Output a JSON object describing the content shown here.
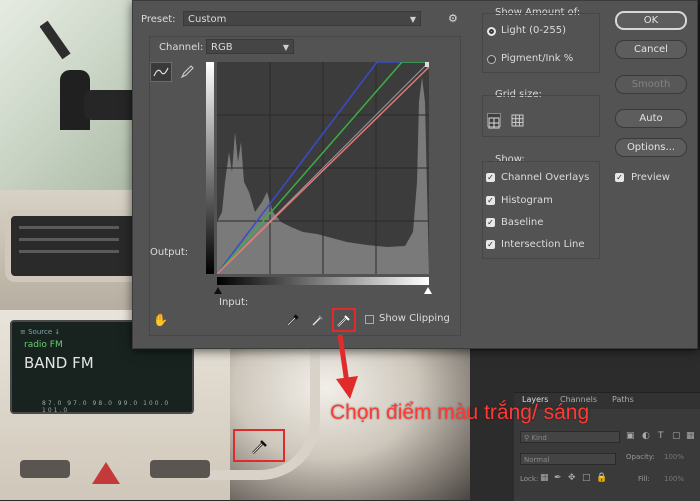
{
  "dialog": {
    "preset_label": "Preset:",
    "preset_value": "Custom",
    "channel_label": "Channel:",
    "channel_value": "RGB",
    "output_label": "Output:",
    "input_label": "Input:",
    "show_clipping_label": "Show Clipping",
    "show_amount": {
      "title": "Show Amount of:",
      "light": "Light  (0-255)",
      "pigment": "Pigment/Ink %",
      "selected": "light"
    },
    "grid_size": {
      "title": "Grid size:"
    },
    "show": {
      "title": "Show:",
      "channel_overlays": "Channel Overlays",
      "histogram": "Histogram",
      "baseline": "Baseline",
      "intersection_line": "Intersection Line"
    },
    "buttons": {
      "ok": "OK",
      "cancel": "Cancel",
      "smooth": "Smooth",
      "auto": "Auto",
      "options": "Options..."
    },
    "preview_label": "Preview"
  },
  "background_screen": {
    "top_text": "≡ Source ↓",
    "radio": "radio FM",
    "band": "BAND FM",
    "freqs": "87.0  97.0  98.0  99.0  100.0  101.0"
  },
  "layers_panel": {
    "tabs": [
      "Layers",
      "Channels",
      "Paths"
    ],
    "kind": "Kind",
    "blend": "Normal",
    "opacity": "Opacity:",
    "opacity_value": "100%",
    "lock": "Lock:",
    "fill": "Fill:",
    "fill_value": "100%"
  },
  "annotation": {
    "caption": "Chọn điểm màu trắng/ sáng",
    "color": "#e12a2a"
  }
}
